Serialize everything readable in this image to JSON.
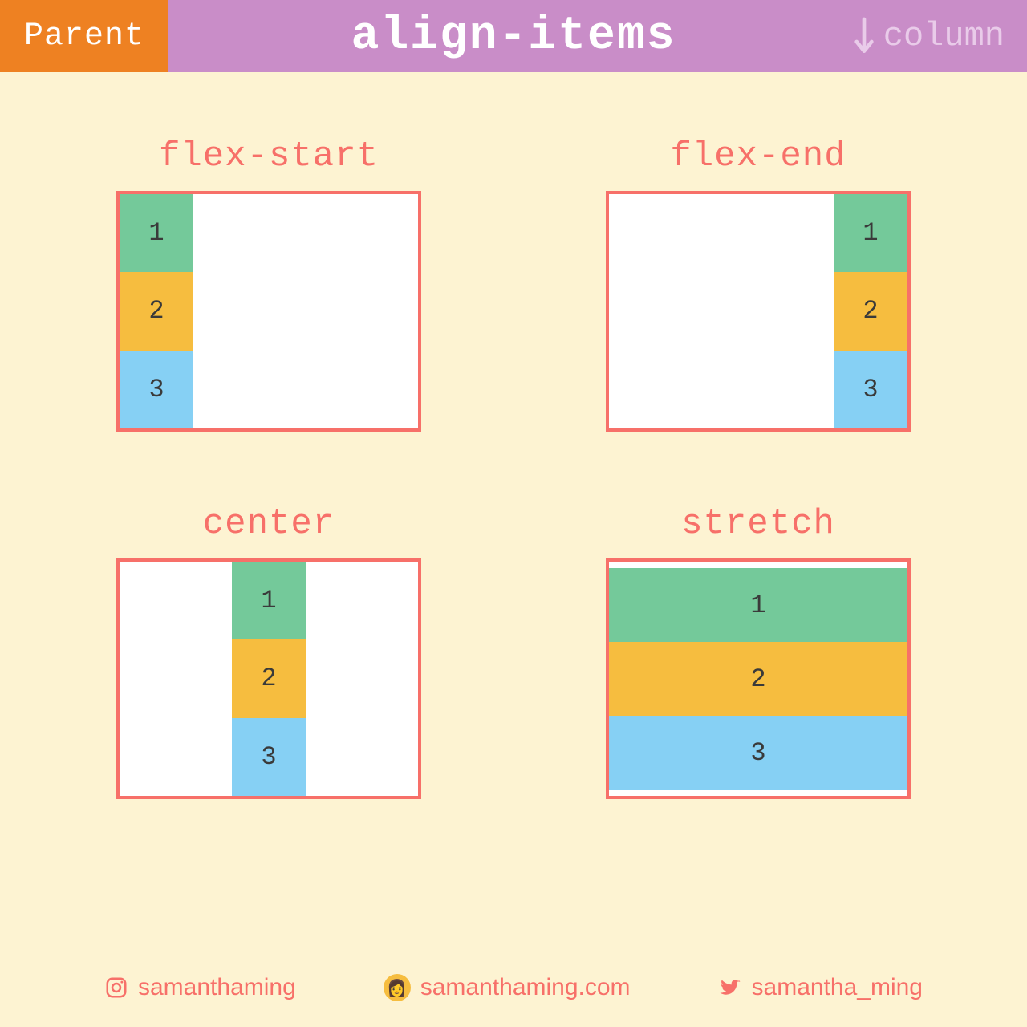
{
  "header": {
    "badge": "Parent",
    "title": "align-items",
    "direction": "column"
  },
  "examples": [
    {
      "label": "flex-start",
      "align": "start",
      "items": [
        "1",
        "2",
        "3"
      ]
    },
    {
      "label": "flex-end",
      "align": "end",
      "items": [
        "1",
        "2",
        "3"
      ]
    },
    {
      "label": "center",
      "align": "center",
      "items": [
        "1",
        "2",
        "3"
      ]
    },
    {
      "label": "stretch",
      "align": "stretch",
      "items": [
        "1",
        "2",
        "3"
      ]
    }
  ],
  "footer": {
    "instagram": "samanthaming",
    "website": "samanthaming.com",
    "twitter": "samantha_ming"
  },
  "colors": {
    "accent": "#f77069",
    "headerBg": "#c98dc8",
    "badgeBg": "#ee8122",
    "pageBg": "#fdf3d2",
    "item1": "#74c99a",
    "item2": "#f6bd3f",
    "item3": "#86d0f4"
  }
}
